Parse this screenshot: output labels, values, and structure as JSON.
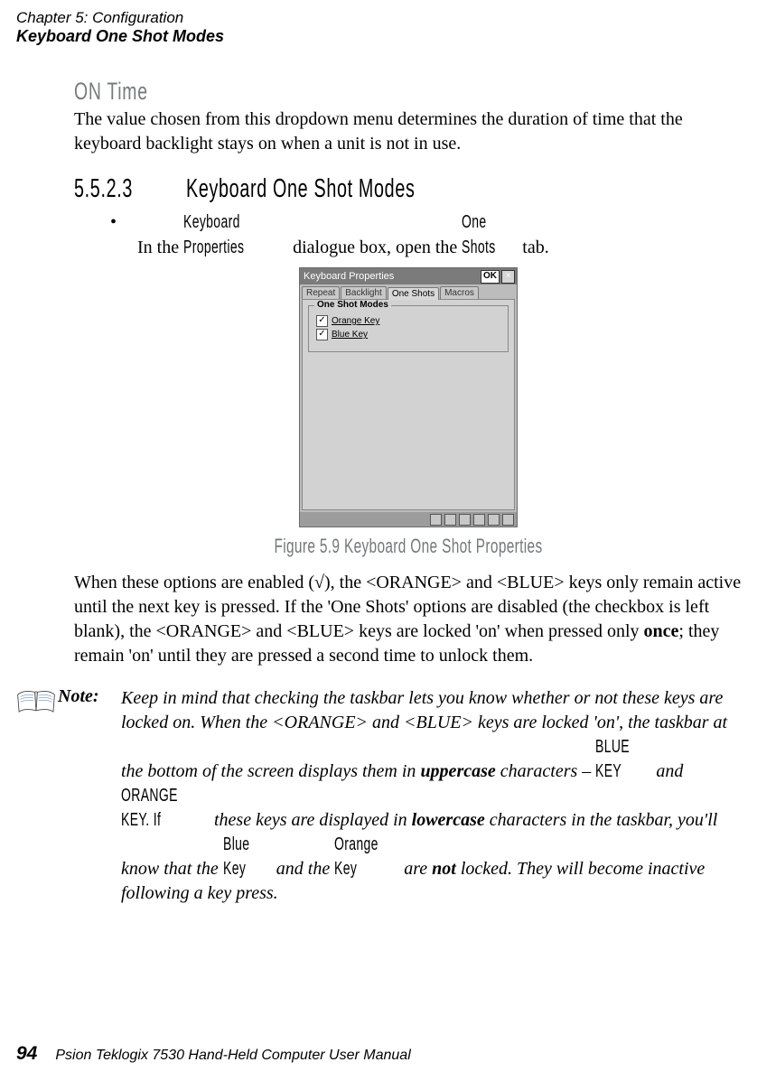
{
  "header": {
    "chapter": "Chapter 5: Configuration",
    "section": "Keyboard One Shot Modes"
  },
  "onTime": {
    "title": "ON Time",
    "text": "The value chosen from this dropdown menu determines the duration of time that the keyboard backlight stays on when a unit is not in use."
  },
  "heading": {
    "number": "5.5.2.3",
    "title": "Keyboard One Shot Modes"
  },
  "bullet": {
    "pre": "In the ",
    "cond1": "Keyboard Properties",
    "mid": " dialogue box, open the ",
    "cond2": "One Shots",
    "post": " tab."
  },
  "device": {
    "title": "Keyboard Properties",
    "okLabel": "OK",
    "closeLabel": "×",
    "tabs": [
      "Repeat",
      "Backlight",
      "One Shots",
      "Macros"
    ],
    "activeTabIndex": 2,
    "groupTitle": "One Shot Modes",
    "checks": [
      {
        "label": "Orange Key",
        "checked": true
      },
      {
        "label": "Blue Key",
        "checked": true
      }
    ]
  },
  "figureCaption": "Figure 5.9 Keyboard One Shot Properties",
  "mainParagraph": {
    "p1": "When these options are enabled (√), the <ORANGE> and <BLUE> keys only remain active until the next key is pressed. If the 'One Shots' options are disabled (the checkbox is left blank), the <ORANGE> and <BLUE> keys are locked 'on' when pressed only ",
    "bold1": "once",
    "p2": "; they remain 'on' until they are pressed a second time to unlock them."
  },
  "note": {
    "label": "Note:",
    "t1": "Keep in mind that checking the taskbar lets you know whether or not these keys are locked on. When the <ORANGE> and <BLUE> keys are locked 'on', the taskbar at the bottom of the screen displays them in ",
    "b1": "uppercase",
    "t2": " characters – ",
    "c1": "BLUE KEY",
    "t3": " and ",
    "c2": "ORANGE KEY. If",
    "t4": " these keys are displayed in ",
    "b2": "lowercase",
    "t5": " characters in the taskbar, you'll know that the ",
    "c3": "Blue Key",
    "t6": " and the ",
    "c4": "Orange Key",
    "t7": " are ",
    "b3": "not",
    "t8": " locked. They will become inactive following a key press."
  },
  "footer": {
    "pageNumber": "94",
    "text": "Psion Teklogix 7530 Hand-Held Computer User Manual"
  }
}
